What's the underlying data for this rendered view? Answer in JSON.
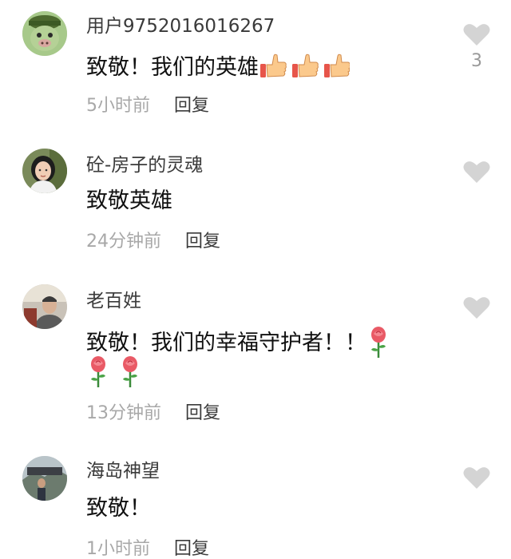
{
  "comments": [
    {
      "username": "用户9752016016267",
      "text": "致敬！我们的英雄",
      "time": "5小时前",
      "reply": "回复",
      "likes": "3",
      "emoji": "thumbs-up"
    },
    {
      "username": "砼-房子的灵魂",
      "text": "致敬英雄",
      "time": "24分钟前",
      "reply": "回复"
    },
    {
      "username": "老百姓",
      "text": "致敬！我们的幸福守护者！！",
      "time": "13分钟前",
      "reply": "回复",
      "emoji": "rose"
    },
    {
      "username": "海岛神望",
      "text": "致敬！",
      "time": "1小时前",
      "reply": "回复"
    }
  ],
  "colors": {
    "username": "#3a3a3a",
    "text": "#111111",
    "time": "#a8a8a8",
    "like_icon": "#d4d4d4"
  }
}
